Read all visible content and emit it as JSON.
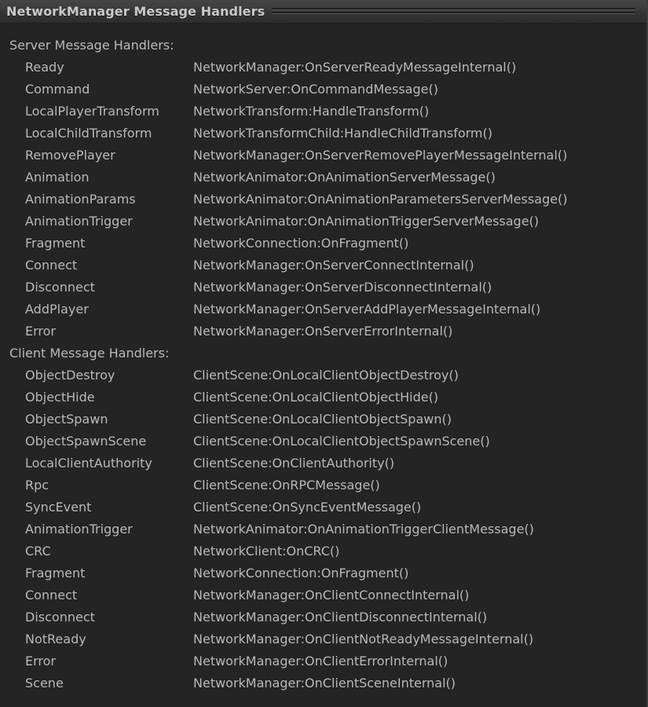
{
  "window": {
    "title": "NetworkManager Message Handlers",
    "background_color": "#242424",
    "titlebar_color": "#3c3c3c",
    "text_color": "#b9b9b9"
  },
  "sections": [
    {
      "header": "Server Message Handlers:",
      "rows": [
        {
          "key": "Ready",
          "val": "NetworkManager:OnServerReadyMessageInternal()"
        },
        {
          "key": "Command",
          "val": "NetworkServer:OnCommandMessage()"
        },
        {
          "key": "LocalPlayerTransform",
          "val": "NetworkTransform:HandleTransform()"
        },
        {
          "key": "LocalChildTransform",
          "val": "NetworkTransformChild:HandleChildTransform()"
        },
        {
          "key": "RemovePlayer",
          "val": "NetworkManager:OnServerRemovePlayerMessageInternal()"
        },
        {
          "key": "Animation",
          "val": "NetworkAnimator:OnAnimationServerMessage()"
        },
        {
          "key": "AnimationParams",
          "val": "NetworkAnimator:OnAnimationParametersServerMessage()"
        },
        {
          "key": "AnimationTrigger",
          "val": "NetworkAnimator:OnAnimationTriggerServerMessage()"
        },
        {
          "key": "Fragment",
          "val": "NetworkConnection:OnFragment()"
        },
        {
          "key": "Connect",
          "val": "NetworkManager:OnServerConnectInternal()"
        },
        {
          "key": "Disconnect",
          "val": "NetworkManager:OnServerDisconnectInternal()"
        },
        {
          "key": "AddPlayer",
          "val": "NetworkManager:OnServerAddPlayerMessageInternal()"
        },
        {
          "key": "Error",
          "val": "NetworkManager:OnServerErrorInternal()"
        }
      ]
    },
    {
      "header": "Client Message Handlers:",
      "rows": [
        {
          "key": "ObjectDestroy",
          "val": "ClientScene:OnLocalClientObjectDestroy()"
        },
        {
          "key": "ObjectHide",
          "val": "ClientScene:OnLocalClientObjectHide()"
        },
        {
          "key": "ObjectSpawn",
          "val": "ClientScene:OnLocalClientObjectSpawn()"
        },
        {
          "key": "ObjectSpawnScene",
          "val": "ClientScene:OnLocalClientObjectSpawnScene()"
        },
        {
          "key": "LocalClientAuthority",
          "val": "ClientScene:OnClientAuthority()"
        },
        {
          "key": "Rpc",
          "val": "ClientScene:OnRPCMessage()"
        },
        {
          "key": "SyncEvent",
          "val": "ClientScene:OnSyncEventMessage()"
        },
        {
          "key": "AnimationTrigger",
          "val": "NetworkAnimator:OnAnimationTriggerClientMessage()"
        },
        {
          "key": "CRC",
          "val": "NetworkClient:OnCRC()"
        },
        {
          "key": "Fragment",
          "val": "NetworkConnection:OnFragment()"
        },
        {
          "key": "Connect",
          "val": "NetworkManager:OnClientConnectInternal()"
        },
        {
          "key": "Disconnect",
          "val": "NetworkManager:OnClientDisconnectInternal()"
        },
        {
          "key": "NotReady",
          "val": "NetworkManager:OnClientNotReadyMessageInternal()"
        },
        {
          "key": "Error",
          "val": "NetworkManager:OnClientErrorInternal()"
        },
        {
          "key": "Scene",
          "val": "NetworkManager:OnClientSceneInternal()"
        }
      ]
    }
  ]
}
